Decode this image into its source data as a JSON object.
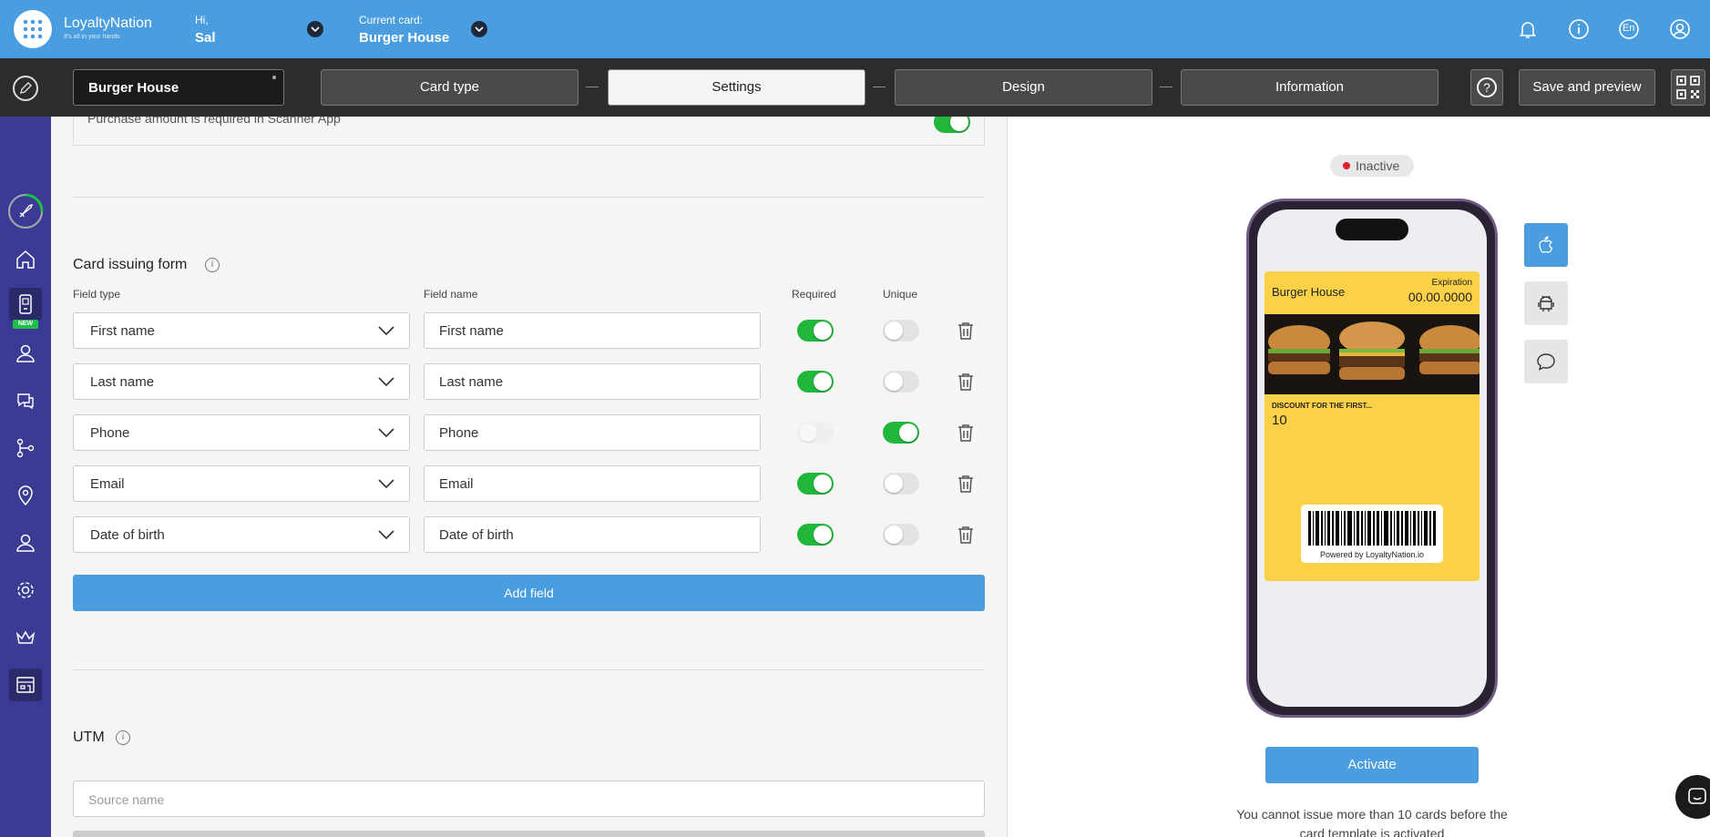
{
  "header": {
    "brand": "LoyaltyNation",
    "tagline": "It's all in your hands",
    "greeting": "Hi,",
    "user": "Sal",
    "current_card_label": "Current card:",
    "current_card_value": "Burger House",
    "language": "En"
  },
  "toolbar": {
    "card_name": "Burger House",
    "steps": [
      "Card type",
      "Settings",
      "Design",
      "Information"
    ],
    "active_step": "Settings",
    "help_label": "?",
    "save_label": "Save and preview"
  },
  "sidebar": {
    "items": [
      "rocket",
      "home",
      "scanner-app",
      "customers",
      "chat",
      "flows",
      "locations",
      "users",
      "settings",
      "crown",
      "store"
    ],
    "new_badge": "NEW"
  },
  "main": {
    "top_row_text": "Purchase amount is required in Scanner App",
    "card_form": {
      "title": "Card issuing form",
      "col_field_type": "Field type",
      "col_field_name": "Field name",
      "col_required": "Required",
      "col_unique": "Unique",
      "rows": [
        {
          "type": "First name",
          "name": "First name",
          "required": true,
          "unique": false
        },
        {
          "type": "Last name",
          "name": "Last name",
          "required": true,
          "unique": false
        },
        {
          "type": "Phone",
          "name": "Phone",
          "required": false,
          "unique": true
        },
        {
          "type": "Email",
          "name": "Email",
          "required": true,
          "unique": false
        },
        {
          "type": "Date of birth",
          "name": "Date of birth",
          "required": true,
          "unique": false
        }
      ],
      "add_label": "Add field"
    },
    "utm": {
      "title": "UTM",
      "source_placeholder": "Source name"
    }
  },
  "preview": {
    "status": "Inactive",
    "status_color": "#e0202c",
    "pass": {
      "name": "Burger House",
      "expiration_label": "Expiration",
      "expiration_value": "00.00.0000",
      "discount_label": "DISCOUNT FOR THE FIRST...",
      "discount_value": "10",
      "powered_by": "Powered by LoyaltyNation.io"
    },
    "activate_label": "Activate",
    "notice": "You cannot issue more than 10 cards before the card template is activated"
  },
  "colors": {
    "accent": "#4a9ee0",
    "sidebar": "#3b3b95",
    "toggle_on": "#21b73b",
    "pass": "#fbd148"
  }
}
